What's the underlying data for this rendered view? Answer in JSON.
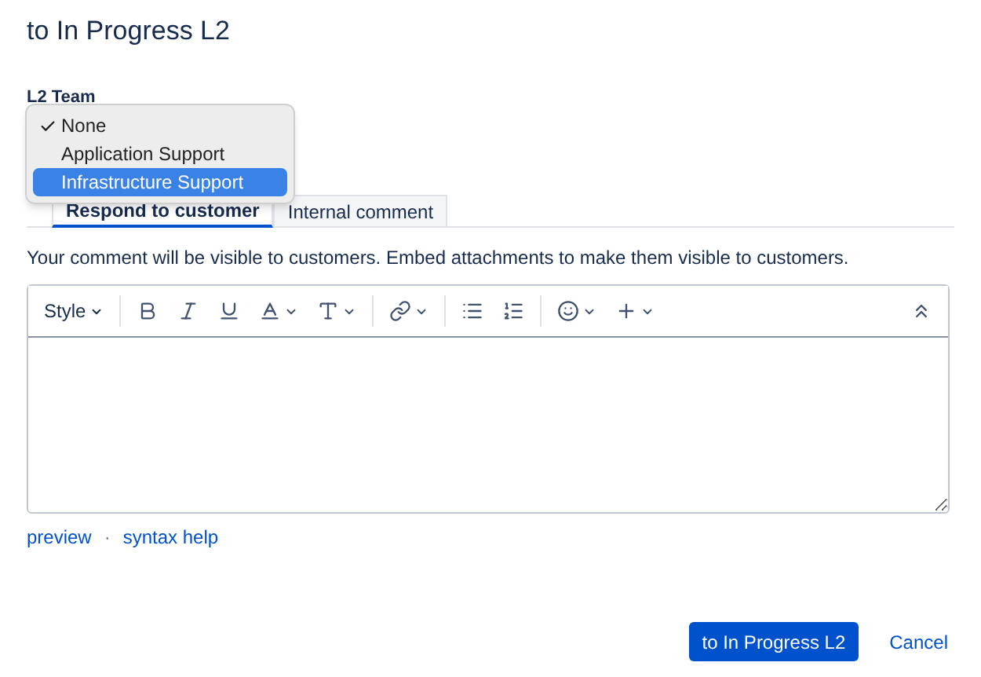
{
  "title": "to In Progress L2",
  "field": {
    "label": "L2 Team",
    "options": [
      {
        "label": "None",
        "checked": true,
        "selected": false
      },
      {
        "label": "Application Support",
        "checked": false,
        "selected": false
      },
      {
        "label": "Infrastructure Support",
        "checked": false,
        "selected": true
      }
    ]
  },
  "tabs": [
    {
      "label": "Respond to customer",
      "selected": true
    },
    {
      "label": "Internal comment",
      "selected": false
    }
  ],
  "notice": "Your comment will be visible to customers. Embed attachments to make them visible to customers.",
  "editor": {
    "style_label": "Style"
  },
  "links": [
    {
      "label": "preview"
    },
    {
      "label": "syntax help"
    }
  ],
  "link_separator": "·",
  "buttons": [
    {
      "label": "to In Progress L2",
      "kind": "primary"
    },
    {
      "label": "Cancel",
      "kind": "link"
    }
  ]
}
